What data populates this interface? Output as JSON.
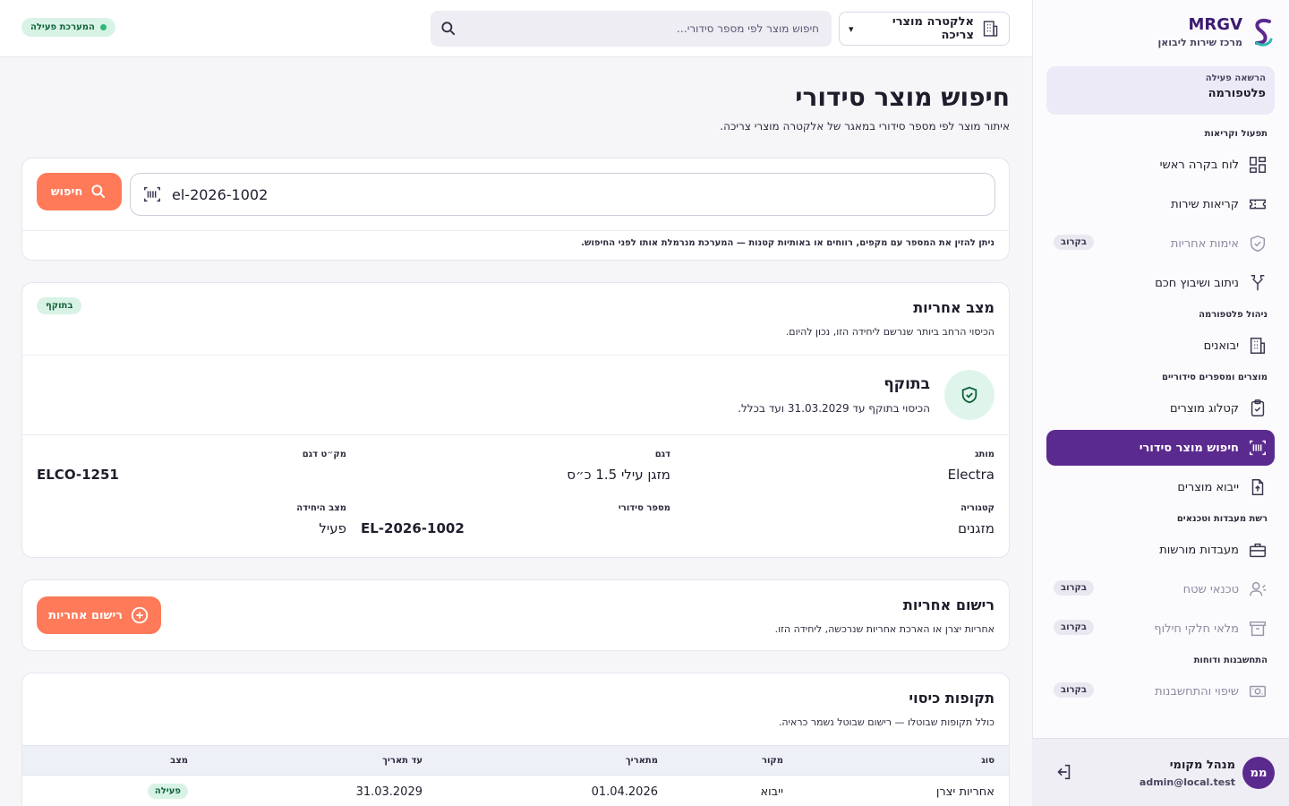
{
  "brand": {
    "name": "MRGV",
    "subtitle": "מרכז שירות ליבואן"
  },
  "tenant": {
    "label": "הרשאה פעילה",
    "value": "פלטפורמה"
  },
  "nav": {
    "sections": [
      {
        "title": "תפעול וקריאות",
        "items": [
          {
            "label": "לוח בקרה ראשי",
            "icon": "dashboard-icon"
          },
          {
            "label": "קריאות שירות",
            "icon": "ticket-icon"
          },
          {
            "label": "אימות אחריות",
            "icon": "shield-icon",
            "soon": "בקרוב"
          },
          {
            "label": "ניתוב ושיבוץ חכם",
            "icon": "route-icon"
          }
        ]
      },
      {
        "title": "ניהול פלטפורמה",
        "items": [
          {
            "label": "יבואנים",
            "icon": "building-icon"
          }
        ]
      },
      {
        "title": "מוצרים ומספרים סידוריים",
        "items": [
          {
            "label": "קטלוג מוצרים",
            "icon": "clipboard-icon"
          },
          {
            "label": "חיפוש מוצר סידורי",
            "icon": "barcode-icon",
            "active": true
          },
          {
            "label": "ייבוא מוצרים",
            "icon": "file-upload-icon"
          }
        ]
      },
      {
        "title": "רשת מעבדות וטכנאים",
        "items": [
          {
            "label": "מעבדות מורשות",
            "icon": "toolbox-icon"
          },
          {
            "label": "טכנאי שטח",
            "icon": "technician-icon",
            "soon": "בקרוב"
          },
          {
            "label": "מלאי חלקי חילוף",
            "icon": "archive-icon",
            "soon": "בקרוב"
          }
        ]
      },
      {
        "title": "התחשבנות ודוחות",
        "items": [
          {
            "label": "שיפוי והתחשבנות",
            "icon": "money-icon",
            "soon": "בקרוב"
          }
        ]
      }
    ]
  },
  "user": {
    "initials": "ממ",
    "name": "מנהל מקומי",
    "email": "admin@local.test"
  },
  "topbar": {
    "tenant_select": "אלקטרה מוצרי צריכה",
    "search_placeholder": "חיפוש מוצר לפי מספר סידורי…",
    "system_status": "המערכת פעילה"
  },
  "page": {
    "title": "חיפוש מוצר סידורי",
    "subtitle": "איתור מוצר לפי מספר סידורי במאגר של אלקטרה מוצרי צריכה."
  },
  "serial_search": {
    "value": "el-2026-1002",
    "button": "חיפוש",
    "hint": "ניתן להזין את המספר עם מקפים, רווחים או באותיות קטנות — המערכת מנרמלת אותו לפני החיפוש."
  },
  "warranty": {
    "title": "מצב אחריות",
    "subtitle": "הכיסוי הרחב ביותר שנרשם ליחידה הזו, נכון להיום.",
    "badge": "בתוקף",
    "status_title": "בתוקף",
    "status_text": "הכיסוי בתוקף עד 31.03.2029 ועד בכלל.",
    "fields": {
      "brand_label": "מותג",
      "brand": "Electra",
      "model_label": "דגם",
      "model": "מזגן עילי 1.5 כ״ס",
      "sku_label": "מק״ט דגם",
      "sku": "ELCO-1251",
      "category_label": "קטגוריה",
      "category": "מזגנים",
      "serial_label": "מספר סידורי",
      "serial": "EL-2026-1002",
      "unit_status_label": "מצב היחידה",
      "unit_status": "פעיל"
    }
  },
  "registration": {
    "title": "רישום אחריות",
    "subtitle": "אחריות יצרן או הארכת אחריות שנרכשה, ליחידה הזו.",
    "button": "רישום אחריות"
  },
  "coverage": {
    "title": "תקופות כיסוי",
    "subtitle": "כולל תקופות שבוטלו — רישום שבוטל נשמר כראיה.",
    "columns": {
      "type": "סוג",
      "source": "מקור",
      "from": "מתאריך",
      "to": "עד תאריך",
      "status": "מצב"
    },
    "rows": [
      {
        "type": "אחריות יצרן",
        "source": "ייבוא",
        "from": "01.04.2026",
        "to": "31.03.2029",
        "status": "פעילה"
      }
    ]
  },
  "colors": {
    "primary": "#5b2a8f",
    "accent": "#ff7a59",
    "success_bg": "#d8f3e6",
    "success_text": "#11623a"
  }
}
